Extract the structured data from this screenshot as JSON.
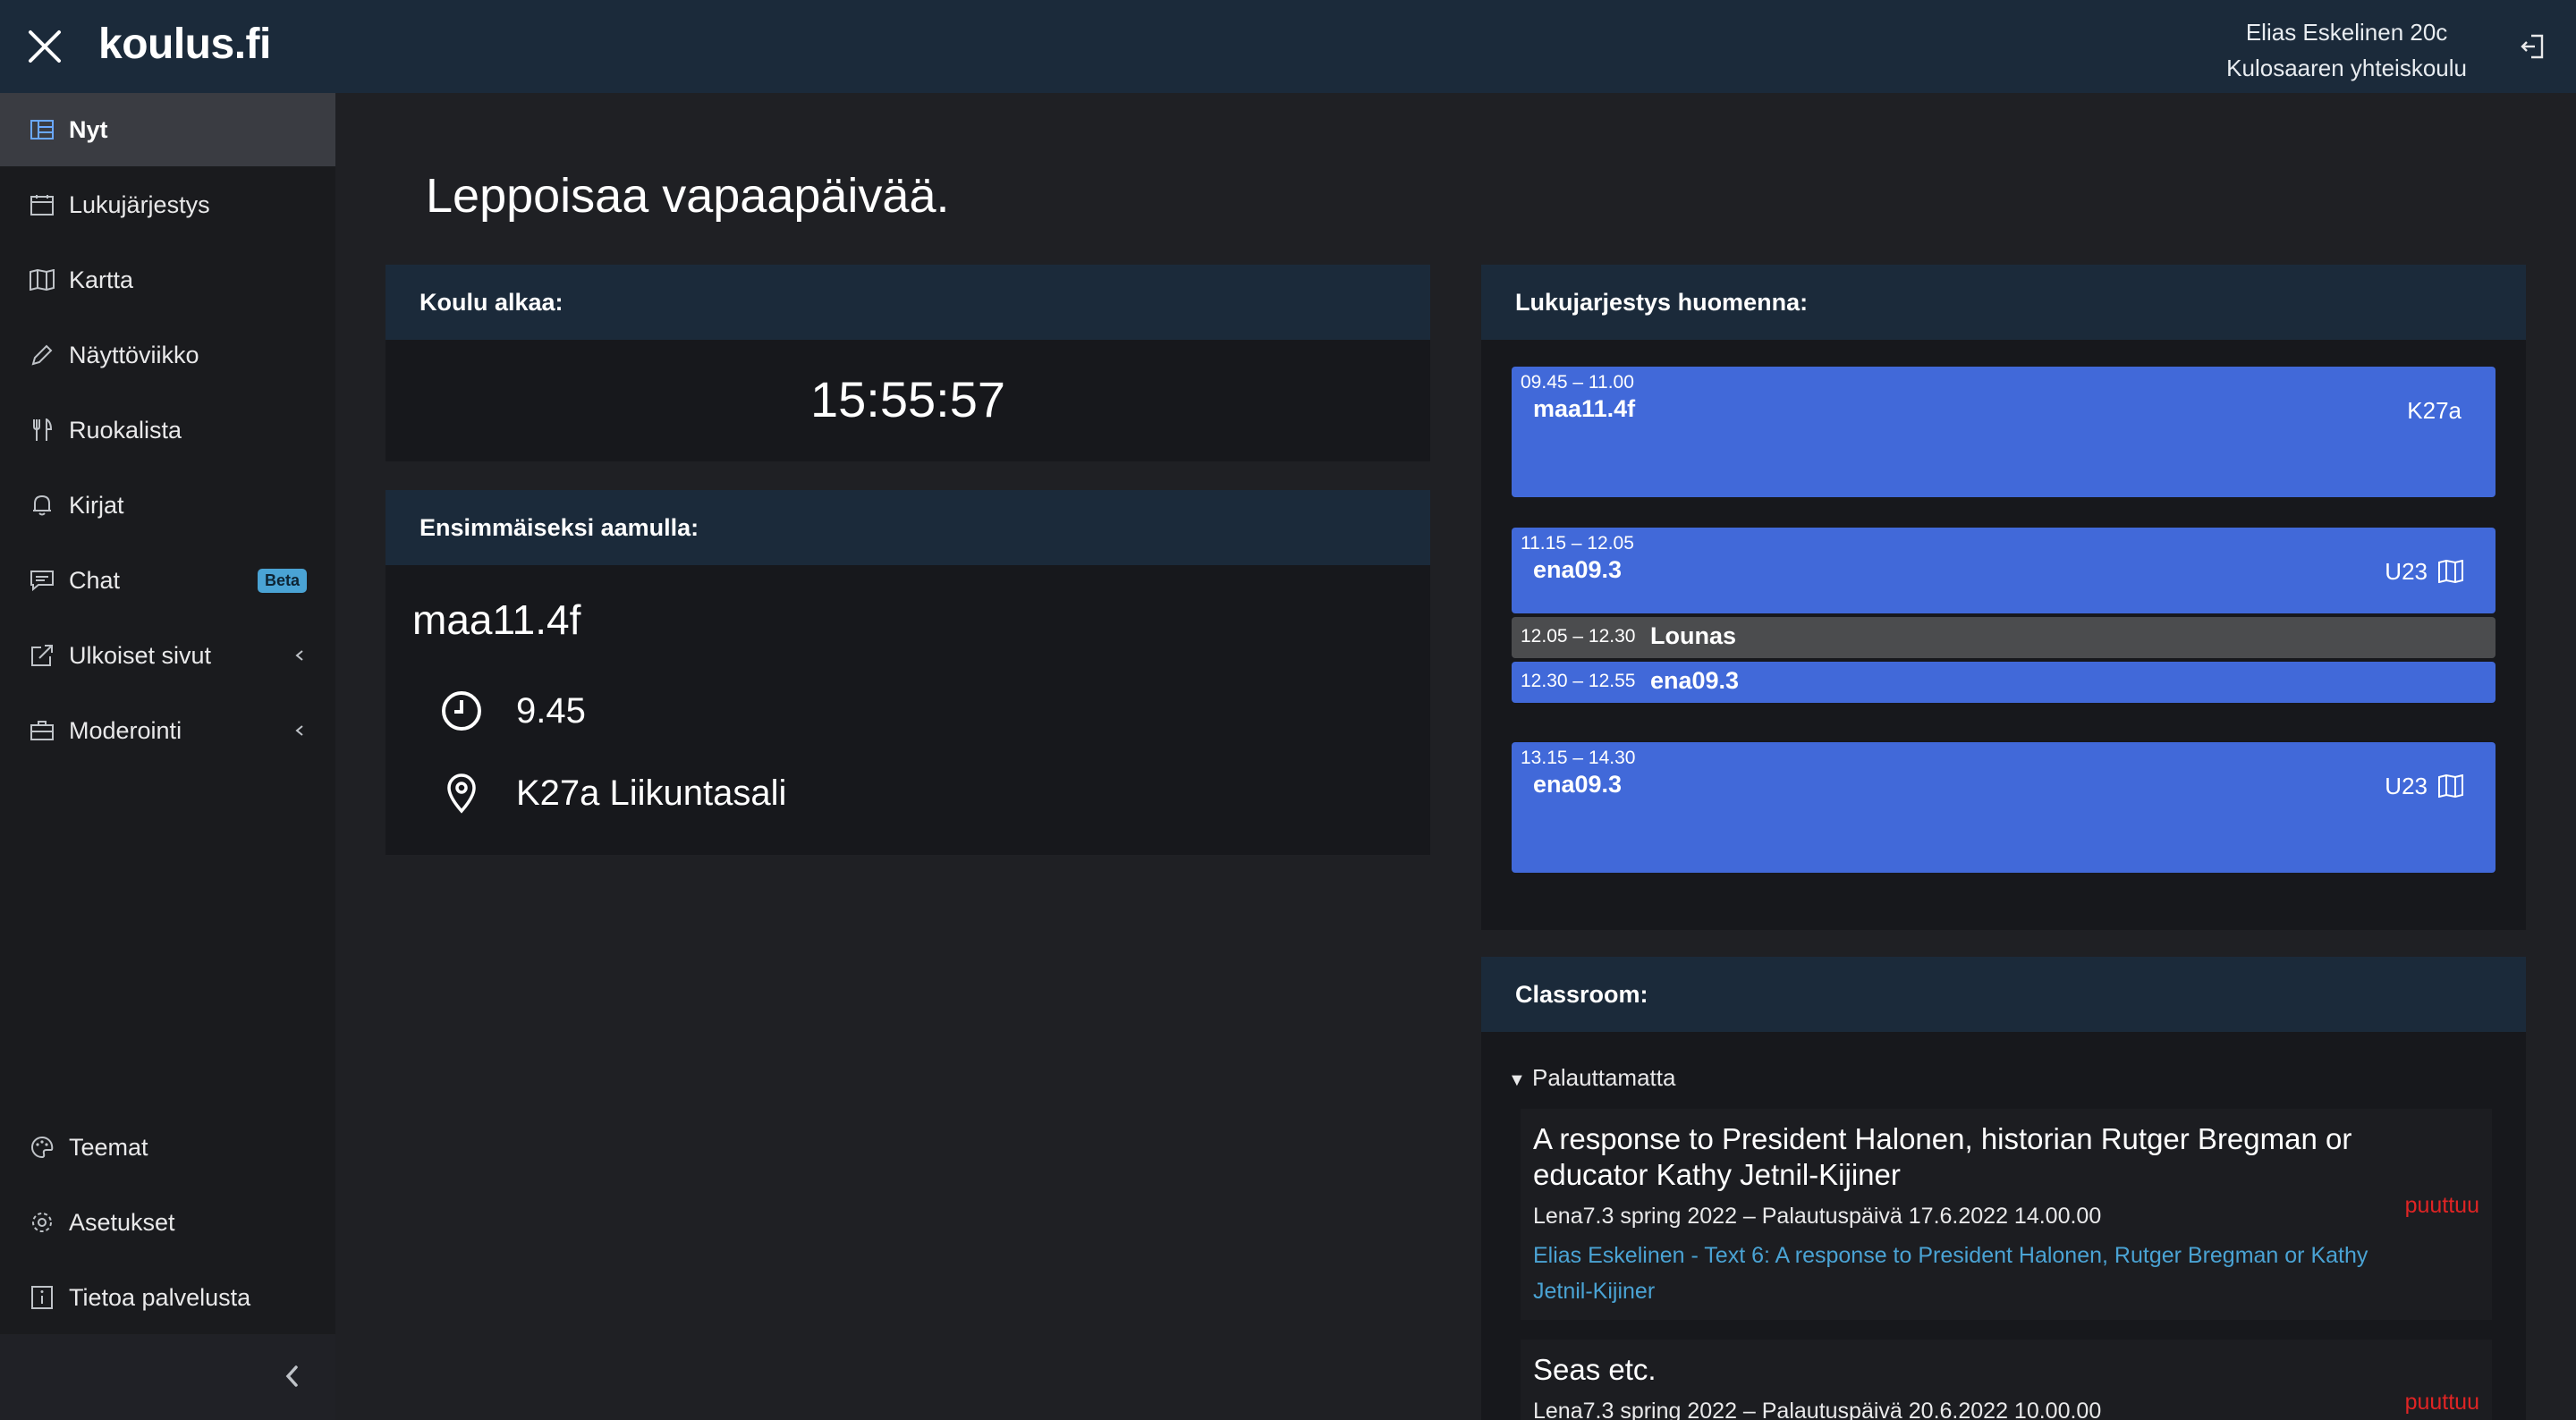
{
  "header": {
    "brand": "koulus.fi",
    "user_name": "Elias Eskelinen 20c",
    "school": "Kulosaaren yhteiskoulu"
  },
  "sidebar": {
    "items": [
      {
        "label": "Nyt",
        "icon": "table-icon"
      },
      {
        "label": "Lukujärjestys",
        "icon": "calendar-icon"
      },
      {
        "label": "Kartta",
        "icon": "map-icon"
      },
      {
        "label": "Näyttöviikko",
        "icon": "pencil-icon"
      },
      {
        "label": "Ruokalista",
        "icon": "utensils-icon"
      },
      {
        "label": "Kirjat",
        "icon": "bell-icon"
      },
      {
        "label": "Chat",
        "icon": "chat-icon",
        "badge": "Beta"
      },
      {
        "label": "Ulkoiset sivut",
        "icon": "external-link-icon"
      },
      {
        "label": "Moderointi",
        "icon": "briefcase-icon"
      },
      {
        "label": "Teemat",
        "icon": "palette-icon"
      },
      {
        "label": "Asetukset",
        "icon": "gear-icon"
      },
      {
        "label": "Tietoa palvelusta",
        "icon": "info-icon"
      }
    ]
  },
  "main": {
    "greeting": "Leppoisaa vapaapäivää.",
    "school_starts": {
      "title": "Koulu alkaa:",
      "countdown": "15:55:57"
    },
    "first_morning": {
      "title": "Ensimmäiseksi aamulla:",
      "course": "maa11.4f",
      "time": "9.45",
      "location": "K27a Liikuntasali"
    },
    "tomorrow": {
      "title": "Lukujarjestys huomenna:",
      "slots": [
        {
          "time": "09.45 – 11.00",
          "course": "maa11.4f",
          "room": "K27a"
        },
        {
          "time": "11.15 – 12.05",
          "course": "ena09.3",
          "room": "U23"
        },
        {
          "time": "12.05 – 12.30",
          "course": "Lounas",
          "room": ""
        },
        {
          "time": "12.30 – 12.55",
          "course": "ena09.3",
          "room": ""
        },
        {
          "time": "13.15 – 14.30",
          "course": "ena09.3",
          "room": "U23"
        }
      ]
    },
    "classroom": {
      "title": "Classroom:",
      "section": "Palauttamatta",
      "assignments": [
        {
          "title": "A response to President Halonen, historian Rutger Bregman or educator Kathy Jetnil-Kijiner",
          "meta": "Lena7.3 spring 2022 – Palautuspäivä 17.6.2022 14.00.00",
          "status": "puuttuu",
          "link": "Elias Eskelinen - Text 6: A response to President Halonen, Rutger Bregman or Kathy Jetnil-Kijiner"
        },
        {
          "title": "Seas etc.",
          "meta": "Lena7.3 spring 2022 – Palautuspäivä 20.6.2022 10.00.00",
          "status": "puuttuu"
        }
      ]
    }
  },
  "colors": {
    "topbar": "#1b2a3a",
    "sidebar": "#1a1b1e",
    "background": "#1f2024",
    "slot_blue": "#4169d9",
    "lunch_gray": "#4b4c4e",
    "link": "#4aa3d4",
    "missing": "#e02424",
    "badge": "#4aa3d4"
  }
}
